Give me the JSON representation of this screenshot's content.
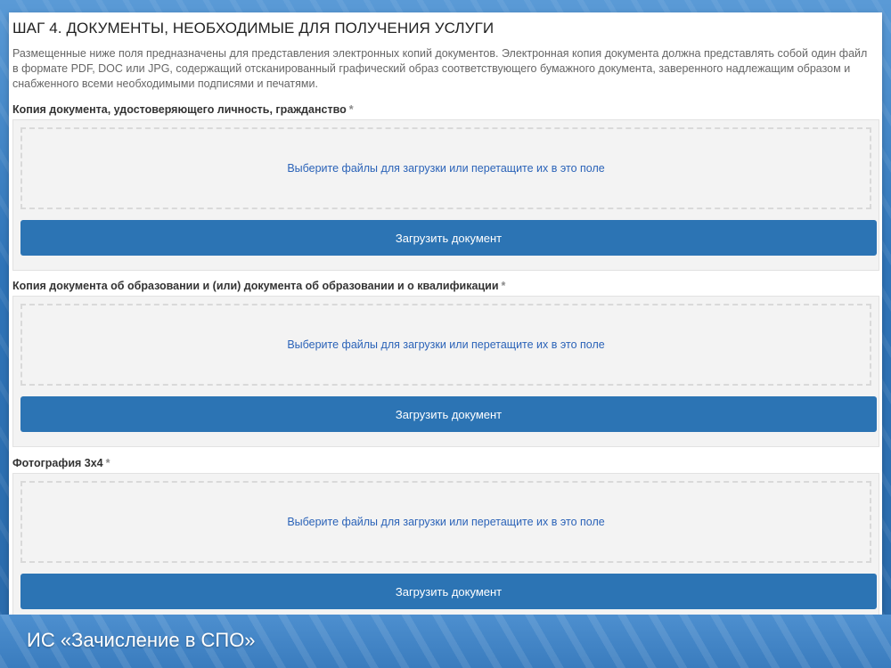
{
  "page": {
    "step_title": "ШАГ 4. ДОКУМЕНТЫ, НЕОБХОДИМЫЕ ДЛЯ ПОЛУЧЕНИЯ УСЛУГИ",
    "intro": "Размещенные ниже поля предназначены для представления электронных копий документов. Электронная копия документа должна представлять собой один файл в формате PDF, DOC или JPG, содержащий отсканированный графический образ соответствующего бумажного документа, заверенного надлежащим образом и снабженного всеми необходимыми подписями и печатями."
  },
  "fields": [
    {
      "label": "Копия документа, удостоверяющего личность, гражданство",
      "required_mark": "*",
      "dropzone_text": "Выберите файлы для загрузки или перетащите их в это поле",
      "button_label": "Загрузить документ"
    },
    {
      "label": "Копия документа об образовании и (или) документа об образовании и о квалификации",
      "required_mark": "*",
      "dropzone_text": "Выберите файлы для загрузки или перетащите их в это поле",
      "button_label": "Загрузить документ"
    },
    {
      "label": "Фотография 3х4",
      "required_mark": "*",
      "dropzone_text": "Выберите файлы для загрузки или перетащите их в это поле",
      "button_label": "Загрузить документ"
    }
  ],
  "slide": {
    "caption": "ИС «Зачисление в СПО»"
  },
  "colors": {
    "button": "#2c74b4",
    "link_text": "#2b63b8",
    "slide_background": "#3d7fc0"
  }
}
